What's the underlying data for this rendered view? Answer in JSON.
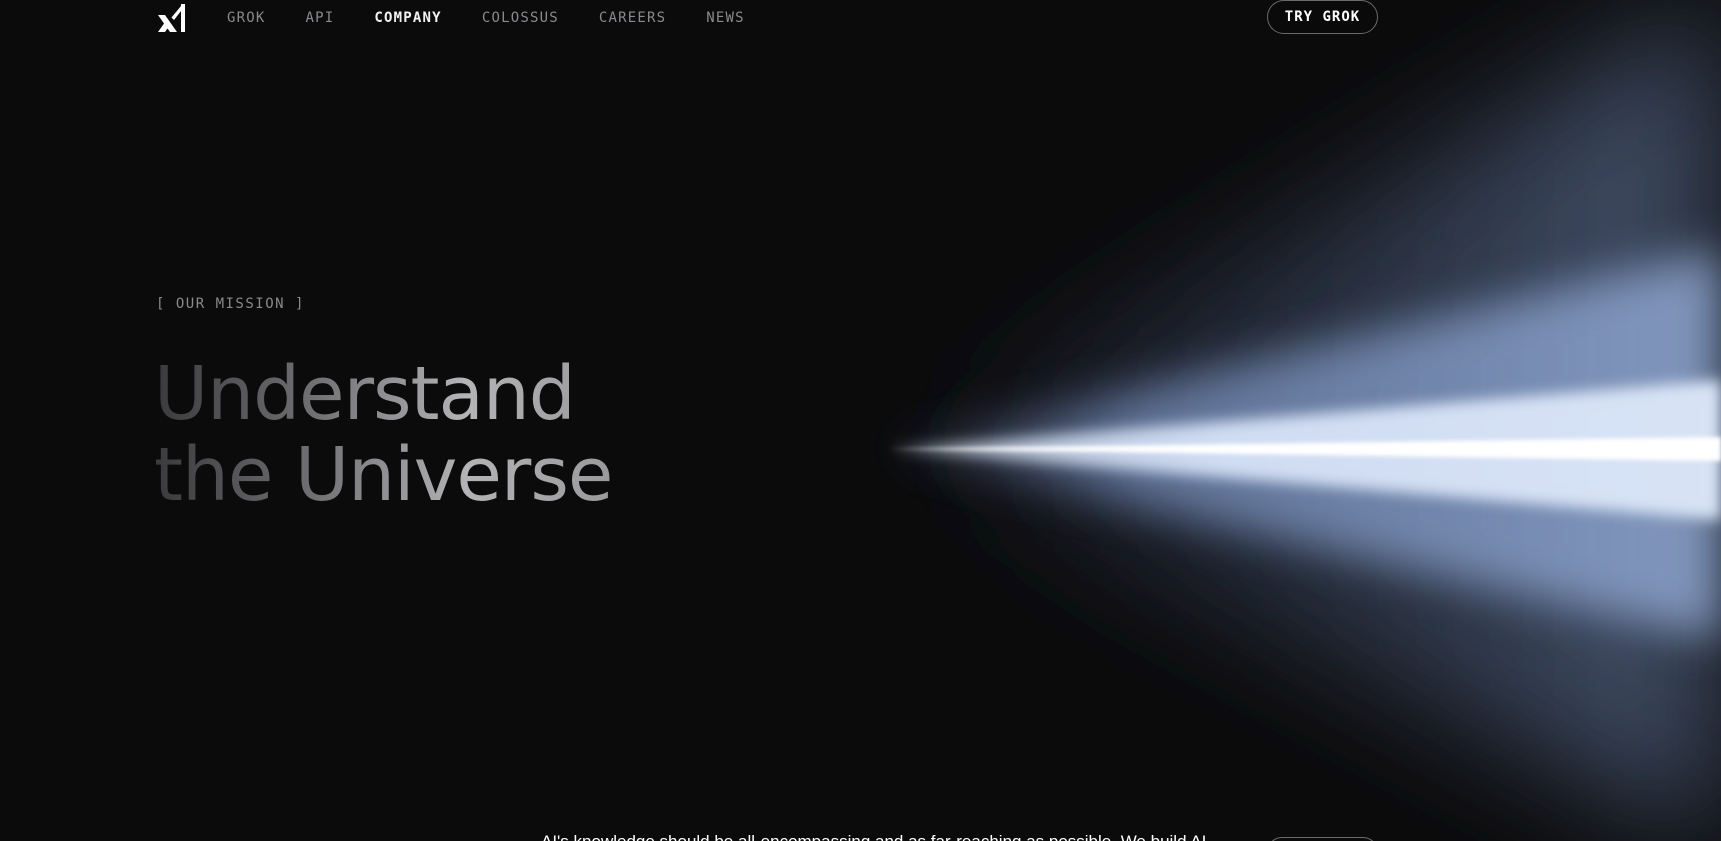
{
  "nav": {
    "logo_label": "xAI",
    "links": [
      {
        "label": "GROK",
        "active": false
      },
      {
        "label": "API",
        "active": false
      },
      {
        "label": "COMPANY",
        "active": true
      },
      {
        "label": "COLOSSUS",
        "active": false
      },
      {
        "label": "CAREERS",
        "active": false
      },
      {
        "label": "NEWS",
        "active": false
      }
    ],
    "cta_label": "TRY GROK"
  },
  "hero": {
    "tag": "[ OUR MISSION ]",
    "headline_line1": "Understand",
    "headline_line2": "the Universe"
  },
  "footer_peek": {
    "text": "AI's knowledge should be all-encompassing and as far-reaching as possible. We build AI"
  },
  "colors": {
    "background": "#0b0b0c",
    "nav_active": "#f2f2f2",
    "nav_inactive": "#8a8a8e",
    "beam_core": "#ffffff",
    "beam_glow": "#9fb4dc"
  }
}
